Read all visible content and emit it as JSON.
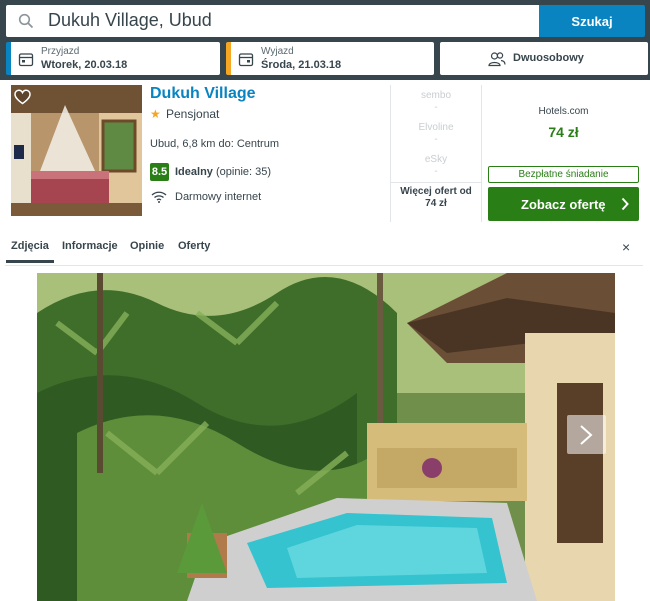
{
  "search": {
    "query": "Dukuh Village, Ubud",
    "button_label": "Szukaj"
  },
  "dates": {
    "checkin_label": "Przyjazd",
    "checkin_value": "Wtorek, 20.03.18",
    "checkout_label": "Wyjazd",
    "checkout_value": "Środa, 21.03.18"
  },
  "room": {
    "label": "Dwuosobowy"
  },
  "hotel": {
    "name": "Dukuh Village",
    "stars": "★",
    "type": "Pensjonat",
    "distance": "Ubud, 6,8 km do: Centrum",
    "rating_score": "8.5",
    "rating_text": "Idealny",
    "rating_count": "(opinie: 35)",
    "amenity": "Darmowy internet"
  },
  "providers": [
    {
      "name": "sembo",
      "price": "-"
    },
    {
      "name": "Elvoline",
      "price": "-"
    },
    {
      "name": "eSky",
      "price": "-"
    }
  ],
  "more_offers": {
    "line1": "Więcej ofert od",
    "line2": "74 zł"
  },
  "deal": {
    "provider": "Hotels.com",
    "price": "74 zł",
    "badge": "Bezpłatne śniadanie",
    "button": "Zobacz ofertę"
  },
  "tabs": [
    {
      "label": "Zdjęcia",
      "active": true
    },
    {
      "label": "Informacje",
      "active": false
    },
    {
      "label": "Opinie",
      "active": false
    },
    {
      "label": "Oferty",
      "active": false
    }
  ],
  "close_label": "×",
  "colors": {
    "topbar": "#37454d",
    "accent_blue": "#0a84c1",
    "accent_orange": "#f5a623",
    "deal_green": "#2a7e16"
  },
  "icons": [
    "search-icon",
    "calendar-icon",
    "users-icon",
    "heart-icon",
    "wifi-icon",
    "chevron-right-icon",
    "close-icon"
  ]
}
